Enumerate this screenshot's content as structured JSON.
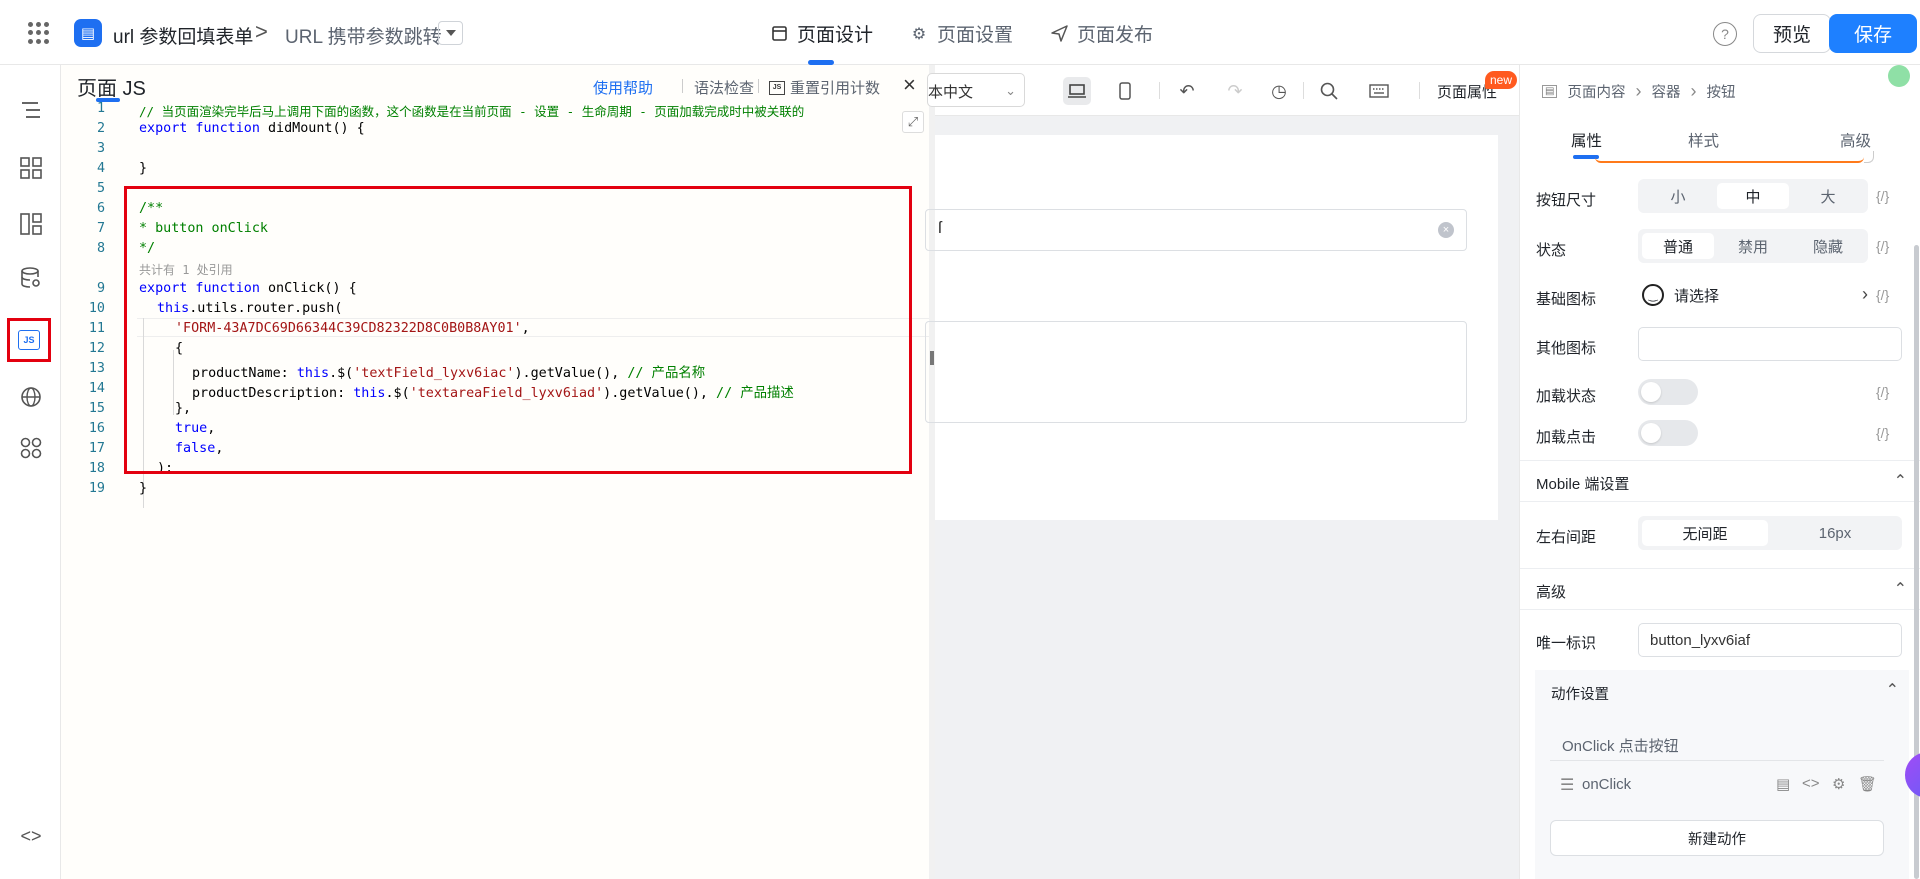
{
  "topbar": {
    "app_name": "url 参数回填表单",
    "breadcrumb_sep": ">",
    "page_name": "URL 携带参数跳转",
    "tabs": [
      {
        "label": "页面设计",
        "icon": "layout-icon",
        "active": true
      },
      {
        "label": "页面设置",
        "icon": "gear-icon",
        "active": false
      },
      {
        "label": "页面发布",
        "icon": "send-icon",
        "active": false
      }
    ],
    "help": "?",
    "preview_label": "预览",
    "save_label": "保存",
    "accent_color": "#1e80ff"
  },
  "rail": {
    "items": [
      "outline-icon",
      "components-icon",
      "templates-icon",
      "datasource-icon",
      "js-icon",
      "globe-icon",
      "apps-icon"
    ],
    "active": "js-icon",
    "js_label": "JS",
    "bottom": "<>"
  },
  "editor": {
    "title": "页面 JS",
    "help_link": "使用帮助",
    "syntax_check": "语法检查",
    "reset_ref": "重置引用计数",
    "js_badge": "JS",
    "close": "×",
    "expand": "⤢",
    "ref_hint": "共计有 1 处引用",
    "line_numbers": [
      "1",
      "2",
      "3",
      "4",
      "5",
      "6",
      "7",
      "8",
      "9",
      "10",
      "11",
      "12",
      "13",
      "14",
      "15",
      "16",
      "17",
      "18",
      "19"
    ],
    "code": {
      "l1": "// 当页面渲染完毕后马上调用下面的函数，这个函数是在当前页面 - 设置 - 生命周期 - 页面加载完成时中被关联的",
      "l2_kw": "export function",
      "l2_rest": " didMount() {",
      "l4": "}",
      "l6": "/**",
      "l7": "* button onClick",
      "l8": "*/",
      "l9_kw": "export function",
      "l9_rest": " onClick() {",
      "l10_kw": "this",
      "l10_rest": ".utils.router.push(",
      "l11": "'FORM-43A7DC69D66344C39CD82322D8C0B0B8AY01'",
      "l11_end": ",",
      "l12": "{",
      "l13_a": "productName: ",
      "l13_kw": "this",
      "l13_b": ".$(",
      "l13_str": "'textField_lyxv6iac'",
      "l13_c": ").getValue(), ",
      "l13_cm": "// 产品名称",
      "l14_a": "productDescription: ",
      "l14_kw": "this",
      "l14_b": ".$(",
      "l14_str": "'textareaField_lyxv6iad'",
      "l14_c": ").getValue(), ",
      "l14_cm": "// 产品描述",
      "l15": "},",
      "l16_kw": "true",
      "l16_end": ",",
      "l17_kw": "false",
      "l17_end": ",",
      "l18": ");",
      "l19": "}"
    },
    "highlight_color": "#e3000f"
  },
  "canvas": {
    "lang": "本中文",
    "page_props": "页面属性",
    "new_badge": "new",
    "input_fragment": "ſ"
  },
  "right_panel": {
    "breadcrumb": [
      "页面内容",
      "容器",
      "按钮"
    ],
    "tabs": [
      {
        "label": "属性",
        "active": true
      },
      {
        "label": "样式",
        "active": false
      },
      {
        "label": "高级",
        "active": false
      }
    ],
    "fx": "{/}",
    "button_size": {
      "label": "按钮尺寸",
      "options": [
        "小",
        "中",
        "大"
      ],
      "selected": "中"
    },
    "state": {
      "label": "状态",
      "options": [
        "普通",
        "禁用",
        "隐藏"
      ],
      "selected": "普通"
    },
    "base_icon": {
      "label": "基础图标",
      "value": "请选择"
    },
    "other_icon": {
      "label": "其他图标",
      "value": ""
    },
    "loading_state": {
      "label": "加载状态",
      "on": false
    },
    "loading_click": {
      "label": "加载点击",
      "on": false
    },
    "mobile_section": "Mobile 端设置",
    "margin": {
      "label": "左右间距",
      "options": [
        "无间距",
        "16px"
      ],
      "selected": "无间距"
    },
    "advanced_section": "高级",
    "uid": {
      "label": "唯一标识",
      "value": "button_lyxv6iaf"
    },
    "action_section": "动作设置",
    "onclick_title": "OnClick 点击按钮",
    "onclick_item": "onClick",
    "new_action": "新建动作"
  }
}
